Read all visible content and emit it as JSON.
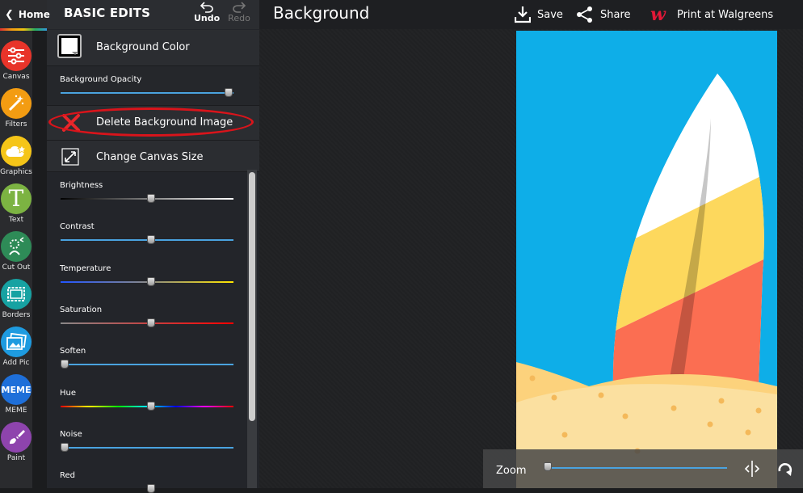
{
  "home": {
    "label": "Home",
    "icon": "chevron-left-icon"
  },
  "tools": [
    {
      "label": "Canvas",
      "icon": "sliders-icon",
      "color": "#e8342a"
    },
    {
      "label": "Filters",
      "icon": "magic-wand-icon",
      "color": "#f39c12"
    },
    {
      "label": "Graphics",
      "icon": "cloud-star-icon",
      "color": "#f5c518"
    },
    {
      "label": "Text",
      "icon": "text-t-icon",
      "color": "#7cb342"
    },
    {
      "label": "Cut Out",
      "icon": "cutout-icon",
      "color": "#2e8b57"
    },
    {
      "label": "Borders",
      "icon": "border-frame-icon",
      "color": "#17a2a2"
    },
    {
      "label": "Add Pic",
      "icon": "add-picture-icon",
      "color": "#1e9be0"
    },
    {
      "label": "MEME",
      "icon": "meme-icon",
      "icon_text": "MEME",
      "color": "#1e6fd9"
    },
    {
      "label": "Paint",
      "icon": "paint-brush-icon",
      "color": "#8e44ad"
    }
  ],
  "panel": {
    "title": "BASIC EDITS",
    "undo_label": "Undo",
    "redo_label": "Redo",
    "background_color_label": "Background Color",
    "background_opacity_label": "Background Opacity",
    "background_opacity": 0.97,
    "delete_bg_label": "Delete Background Image",
    "change_canvas_label": "Change Canvas Size",
    "sliders": [
      {
        "label": "Brightness",
        "value": 0.5
      },
      {
        "label": "Contrast",
        "value": 0.5
      },
      {
        "label": "Temperature",
        "value": 0.5
      },
      {
        "label": "Saturation",
        "value": 0.5
      },
      {
        "label": "Soften",
        "value": 0.0
      },
      {
        "label": "Hue",
        "value": 0.5
      },
      {
        "label": "Noise",
        "value": 0.0
      },
      {
        "label": "Red",
        "value": 0.5
      }
    ]
  },
  "main": {
    "title": "Background",
    "save_label": "Save",
    "share_label": "Share",
    "print_label": "Print at Walgreens",
    "zoom_label": "Zoom",
    "zoom_value": 0.0
  },
  "colors": {
    "accent_blue": "#4aa3df",
    "highlight_red": "#d9141b",
    "sky": "#0eaee8",
    "sand": "#fbe0a0"
  }
}
